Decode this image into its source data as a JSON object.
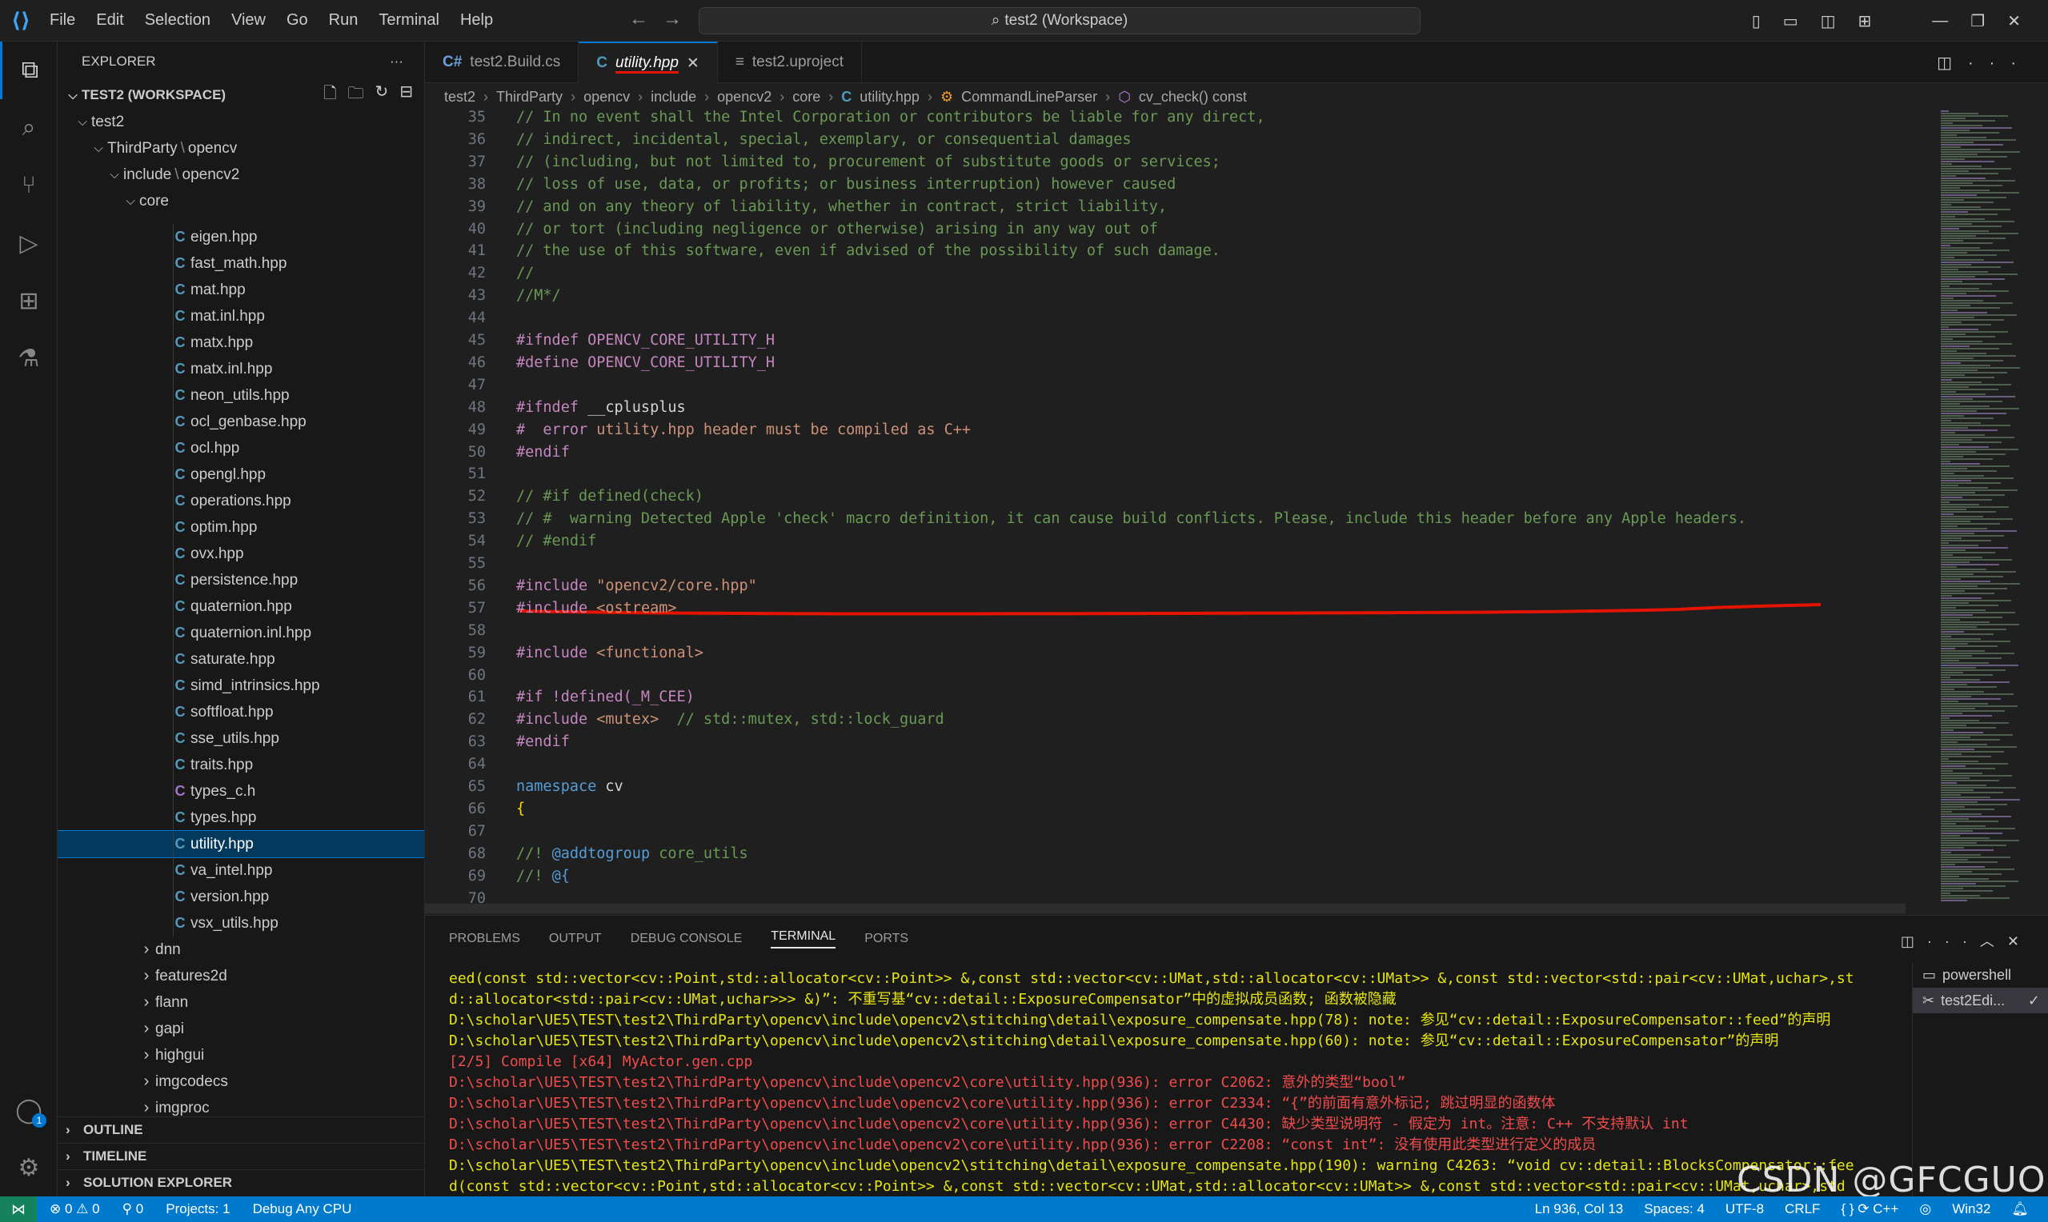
{
  "titlebar": {
    "menu": [
      "File",
      "Edit",
      "Selection",
      "View",
      "Go",
      "Run",
      "Terminal",
      "Help"
    ],
    "search_text": "test2 (Workspace)"
  },
  "explorer": {
    "title": "EXPLORER",
    "workspace": "TEST2 (WORKSPACE)",
    "root": "test2",
    "path1_a": "ThirdParty",
    "path1_b": "opencv",
    "path2_a": "include",
    "path2_b": "opencv2",
    "core": "core",
    "files": [
      {
        "name": "eigen.hpp",
        "icon": "C"
      },
      {
        "name": "fast_math.hpp",
        "icon": "C"
      },
      {
        "name": "mat.hpp",
        "icon": "C"
      },
      {
        "name": "mat.inl.hpp",
        "icon": "C"
      },
      {
        "name": "matx.hpp",
        "icon": "C"
      },
      {
        "name": "matx.inl.hpp",
        "icon": "C"
      },
      {
        "name": "neon_utils.hpp",
        "icon": "C"
      },
      {
        "name": "ocl_genbase.hpp",
        "icon": "C"
      },
      {
        "name": "ocl.hpp",
        "icon": "C"
      },
      {
        "name": "opengl.hpp",
        "icon": "C"
      },
      {
        "name": "operations.hpp",
        "icon": "C"
      },
      {
        "name": "optim.hpp",
        "icon": "C"
      },
      {
        "name": "ovx.hpp",
        "icon": "C"
      },
      {
        "name": "persistence.hpp",
        "icon": "C"
      },
      {
        "name": "quaternion.hpp",
        "icon": "C"
      },
      {
        "name": "quaternion.inl.hpp",
        "icon": "C"
      },
      {
        "name": "saturate.hpp",
        "icon": "C"
      },
      {
        "name": "simd_intrinsics.hpp",
        "icon": "C"
      },
      {
        "name": "softfloat.hpp",
        "icon": "C"
      },
      {
        "name": "sse_utils.hpp",
        "icon": "C"
      },
      {
        "name": "traits.hpp",
        "icon": "C"
      },
      {
        "name": "types_c.h",
        "icon": "C"
      },
      {
        "name": "types.hpp",
        "icon": "C"
      },
      {
        "name": "utility.hpp",
        "icon": "C",
        "selected": true
      },
      {
        "name": "va_intel.hpp",
        "icon": "C"
      },
      {
        "name": "version.hpp",
        "icon": "C"
      },
      {
        "name": "vsx_utils.hpp",
        "icon": "C"
      }
    ],
    "folders": [
      "dnn",
      "features2d",
      "flann",
      "gapi",
      "highgui",
      "imgcodecs",
      "imgproc"
    ],
    "sections": [
      "OUTLINE",
      "TIMELINE",
      "SOLUTION EXPLORER"
    ]
  },
  "tabs": [
    {
      "label": "test2.Build.cs",
      "icon": "C#"
    },
    {
      "label": "utility.hpp",
      "icon": "C",
      "active": true
    },
    {
      "label": "test2.uproject",
      "icon": "≡"
    }
  ],
  "breadcrumb": [
    "test2",
    "ThirdParty",
    "opencv",
    "include",
    "opencv2",
    "core",
    "utility.hpp",
    "CommandLineParser",
    "cv_check() const"
  ],
  "code_lines": [
    {
      "n": "35",
      "t": "// In no event shall the Intel Corporation or contributors be liable for any direct,",
      "c": "com"
    },
    {
      "n": "36",
      "t": "// indirect, incidental, special, exemplary, or consequential damages",
      "c": "com"
    },
    {
      "n": "37",
      "t": "// (including, but not limited to, procurement of substitute goods or services;",
      "c": "com"
    },
    {
      "n": "38",
      "t": "// loss of use, data, or profits; or business interruption) however caused",
      "c": "com"
    },
    {
      "n": "39",
      "t": "// and on any theory of liability, whether in contract, strict liability,",
      "c": "com"
    },
    {
      "n": "40",
      "t": "// or tort (including negligence or otherwise) arising in any way out of",
      "c": "com"
    },
    {
      "n": "41",
      "t": "// the use of this software, even if advised of the possibility of such damage.",
      "c": "com"
    },
    {
      "n": "42",
      "t": "//",
      "c": "com"
    },
    {
      "n": "43",
      "t": "//M*/",
      "c": "com"
    },
    {
      "n": "44",
      "t": "",
      "c": ""
    },
    {
      "n": "45",
      "a": "#ifndef ",
      "b": "OPENCV_CORE_UTILITY_H",
      "c": "ppmac"
    },
    {
      "n": "46",
      "a": "#define ",
      "b": "OPENCV_CORE_UTILITY_H",
      "c": "ppmac"
    },
    {
      "n": "47",
      "t": "",
      "c": ""
    },
    {
      "n": "48",
      "a": "#ifndef ",
      "b": "__cplusplus",
      "c": "ppplain"
    },
    {
      "n": "49",
      "a": "#  error ",
      "b": "utility.hpp header must be compiled as C++",
      "c": "pperr"
    },
    {
      "n": "50",
      "t": "#endif",
      "c": "pp"
    },
    {
      "n": "51",
      "t": "",
      "c": ""
    },
    {
      "n": "52",
      "t": "// #if defined(check)",
      "c": "com"
    },
    {
      "n": "53",
      "t": "// #  warning Detected Apple 'check' macro definition, it can cause build conflicts. Please, include this header before any Apple headers.",
      "c": "com"
    },
    {
      "n": "54",
      "t": "// #endif",
      "c": "com"
    },
    {
      "n": "55",
      "t": "",
      "c": ""
    },
    {
      "n": "56",
      "a": "#include ",
      "b": "\"opencv2/core.hpp\"",
      "c": "ppstr"
    },
    {
      "n": "57",
      "a": "#include ",
      "b": "<ostream>",
      "c": "ppstr"
    },
    {
      "n": "58",
      "t": "",
      "c": ""
    },
    {
      "n": "59",
      "a": "#include ",
      "b": "<functional>",
      "c": "ppstr"
    },
    {
      "n": "60",
      "t": "",
      "c": ""
    },
    {
      "n": "61",
      "a": "#if !defined(",
      "b": "_M_CEE",
      "d": ")",
      "c": "ppif"
    },
    {
      "n": "62",
      "a": "#include ",
      "b": "<mutex>",
      "d": "  // std::mutex, std::lock_guard",
      "c": "ppinc"
    },
    {
      "n": "63",
      "t": "#endif",
      "c": "pp"
    },
    {
      "n": "64",
      "t": "",
      "c": ""
    },
    {
      "n": "65",
      "a": "namespace ",
      "b": "cv",
      "c": "ns"
    },
    {
      "n": "66",
      "t": "{",
      "c": "brace"
    },
    {
      "n": "67",
      "t": "",
      "c": ""
    },
    {
      "n": "68",
      "a": "//! ",
      "b": "@addtogroup",
      "d": " core_utils",
      "c": "doc"
    },
    {
      "n": "69",
      "a": "//! ",
      "b": "@{",
      "c": "doc"
    },
    {
      "n": "70",
      "t": "",
      "c": ""
    }
  ],
  "panel": {
    "tabs": [
      "PROBLEMS",
      "OUTPUT",
      "DEBUG CONSOLE",
      "TERMINAL",
      "PORTS"
    ],
    "active": "TERMINAL",
    "terminals": [
      "powershell",
      "test2Edi..."
    ],
    "lines": [
      {
        "t": "eed(const std::vector<cv::Point,std::allocator<cv::Point>> &,const std::vector<cv::UMat,std::allocator<cv::UMat>> &,const std::vector<std::pair<cv::UMat,uchar>,st",
        "k": "note"
      },
      {
        "t": "d::allocator<std::pair<cv::UMat,uchar>>> &)”: 不重写基“cv::detail::ExposureCompensator”中的虚拟成员函数; 函数被隐藏",
        "k": "note"
      },
      {
        "t": "D:\\scholar\\UE5\\TEST\\test2\\ThirdParty\\opencv\\include\\opencv2\\stitching\\detail\\exposure_compensate.hpp(78): note: 参见“cv::detail::ExposureCompensator::feed”的声明",
        "k": "note"
      },
      {
        "t": "D:\\scholar\\UE5\\TEST\\test2\\ThirdParty\\opencv\\include\\opencv2\\stitching\\detail\\exposure_compensate.hpp(60): note: 参见“cv::detail::ExposureCompensator”的声明",
        "k": "note"
      },
      {
        "t": "[2/5] Compile [x64] MyActor.gen.cpp",
        "k": "err"
      },
      {
        "t": "D:\\scholar\\UE5\\TEST\\test2\\ThirdParty\\opencv\\include\\opencv2\\core\\utility.hpp(936): error C2062: 意外的类型“bool”",
        "k": "err"
      },
      {
        "t": "D:\\scholar\\UE5\\TEST\\test2\\ThirdParty\\opencv\\include\\opencv2\\core\\utility.hpp(936): error C2334: “{”的前面有意外标记; 跳过明显的函数体",
        "k": "err"
      },
      {
        "t": "D:\\scholar\\UE5\\TEST\\test2\\ThirdParty\\opencv\\include\\opencv2\\core\\utility.hpp(936): error C4430: 缺少类型说明符 - 假定为 int。注意: C++ 不支持默认 int",
        "k": "err"
      },
      {
        "t": "D:\\scholar\\UE5\\TEST\\test2\\ThirdParty\\opencv\\include\\opencv2\\core\\utility.hpp(936): error C2208: “const int”: 没有使用此类型进行定义的成员",
        "k": "err"
      },
      {
        "t": "D:\\scholar\\UE5\\TEST\\test2\\ThirdParty\\opencv\\include\\opencv2\\stitching\\detail\\exposure_compensate.hpp(190): warning C4263: “void cv::detail::BlocksCompensator::fee",
        "k": "warn"
      },
      {
        "t": "d(const std::vector<cv::Point,std::allocator<cv::Point>> &,const std::vector<cv::UMat,std::allocator<cv::UMat>> &,const std::vector<std::pair<cv::UMat,uchar>,std",
        "k": "warn"
      }
    ]
  },
  "watermark": "CSDN @GFCGUO",
  "status": {
    "errors": "0",
    "warnings": "0",
    "ports": "0",
    "projects": "Projects: 1",
    "config": "Debug Any CPU",
    "position": "Ln 936, Col 13",
    "spaces": "Spaces: 4",
    "encoding": "UTF-8",
    "eol": "CRLF",
    "lang": "C++",
    "platform": "Win32"
  }
}
